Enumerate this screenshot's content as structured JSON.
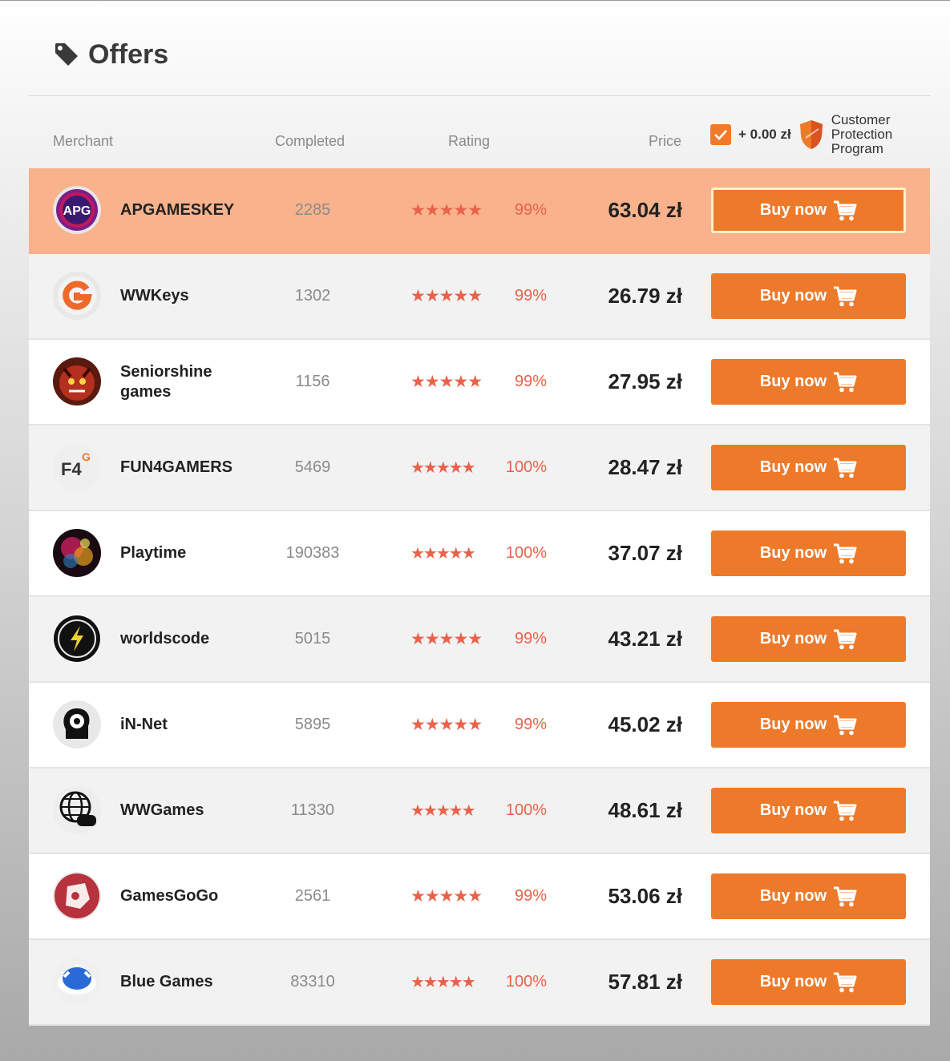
{
  "page": {
    "title": "Offers",
    "title_icon": "tag-icon",
    "columns": {
      "merchant": "Merchant",
      "completed": "Completed",
      "rating": "Rating",
      "price": "Price"
    },
    "protection": {
      "checked": true,
      "amount": "+ 0.00 zł",
      "label": "Customer Protection Program",
      "icon": "shield-icon"
    },
    "colors": {
      "accent": "#ed7a2a",
      "highlight_row": "#f9b28c",
      "rating": "#e8624a"
    }
  },
  "offers": [
    {
      "merchant": "APGAMESKEY",
      "avatar": "apg-logo",
      "completed": "2285",
      "stars": "★★★★★",
      "rating": "99%",
      "price": "63.04 zł",
      "button": "Buy now"
    },
    {
      "merchant": "WWKeys",
      "avatar": "g-logo",
      "completed": "1302",
      "stars": "★★★★★",
      "rating": "99%",
      "price": "26.79 zł",
      "button": "Buy now"
    },
    {
      "merchant": "Seniorshine games",
      "avatar": "demon-logo",
      "completed": "1156",
      "stars": "★★★★★",
      "rating": "99%",
      "price": "27.95 zł",
      "button": "Buy now"
    },
    {
      "merchant": "FUN4GAMERS",
      "avatar": "f4g-logo",
      "completed": "5469",
      "stars": "★★★★★",
      "rating": "100%",
      "price": "28.47 zł",
      "button": "Buy now"
    },
    {
      "merchant": "Playtime",
      "avatar": "fireworks-logo",
      "completed": "190383",
      "stars": "★★★★★",
      "rating": "100%",
      "price": "37.07 zł",
      "button": "Buy now"
    },
    {
      "merchant": "worldscode",
      "avatar": "lightning-logo",
      "completed": "5015",
      "stars": "★★★★★",
      "rating": "99%",
      "price": "43.21 zł",
      "button": "Buy now"
    },
    {
      "merchant": "iN-Net",
      "avatar": "head-gear-logo",
      "completed": "5895",
      "stars": "★★★★★",
      "rating": "99%",
      "price": "45.02 zł",
      "button": "Buy now"
    },
    {
      "merchant": "WWGames",
      "avatar": "globe-gamepad-logo",
      "completed": "11330",
      "stars": "★★★★★",
      "rating": "100%",
      "price": "48.61 zł",
      "button": "Buy now"
    },
    {
      "merchant": "GamesGoGo",
      "avatar": "controller-logo",
      "completed": "2561",
      "stars": "★★★★★",
      "rating": "99%",
      "price": "53.06 zł",
      "button": "Buy now"
    },
    {
      "merchant": "Blue Games",
      "avatar": "blue-shell-logo",
      "completed": "83310",
      "stars": "★★★★★",
      "rating": "100%",
      "price": "57.81 zł",
      "button": "Buy now"
    }
  ]
}
